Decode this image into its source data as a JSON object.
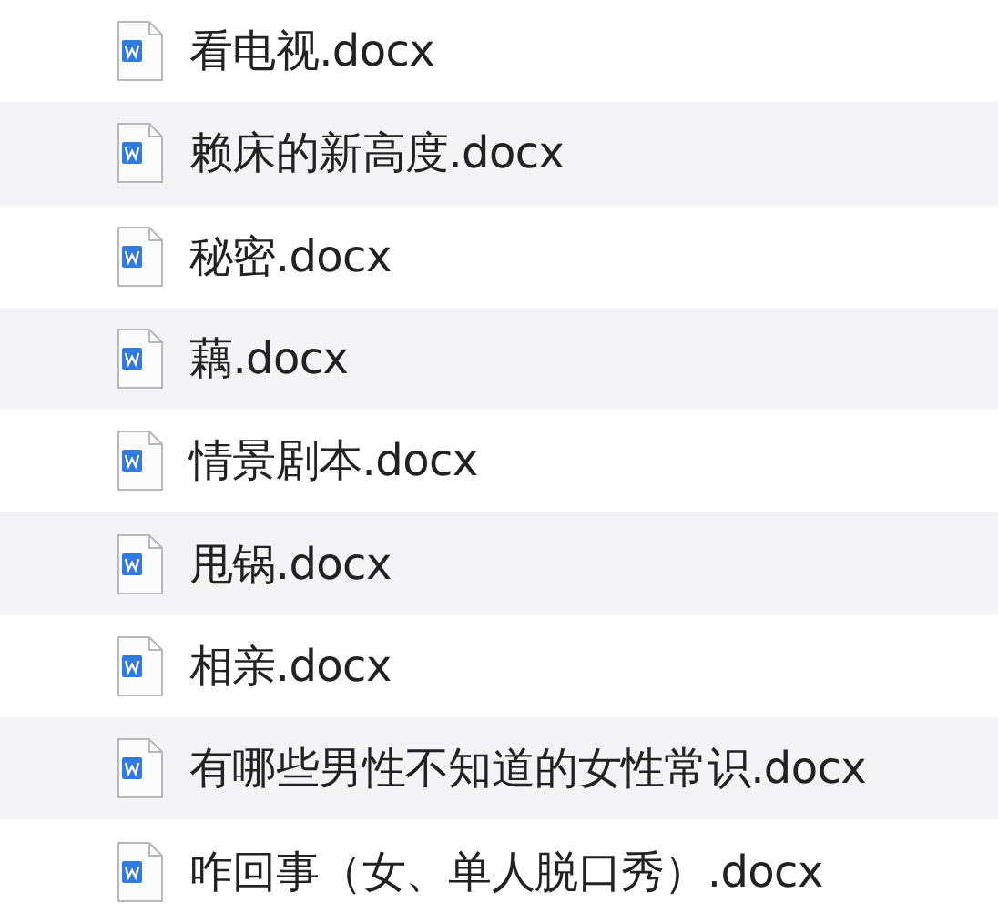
{
  "files": [
    {
      "name": "看电视.docx"
    },
    {
      "name": "赖床的新高度.docx"
    },
    {
      "name": "秘密.docx"
    },
    {
      "name": "藕.docx"
    },
    {
      "name": "情景剧本.docx"
    },
    {
      "name": "甩锅.docx"
    },
    {
      "name": "相亲.docx"
    },
    {
      "name": "有哪些男性不知道的女性常识.docx"
    },
    {
      "name": "咋回事（女、单人脱口秀）.docx"
    }
  ]
}
